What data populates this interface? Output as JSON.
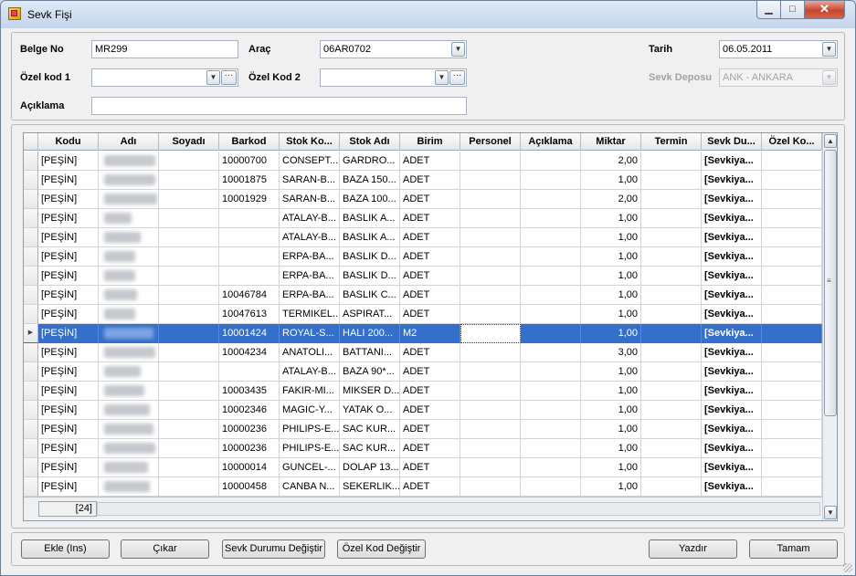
{
  "window": {
    "title": "Sevk Fişi",
    "min_symbol": "▁",
    "max_symbol": "□",
    "close_symbol": "✕"
  },
  "form": {
    "belge_no_label": "Belge No",
    "belge_no_value": "MR299",
    "arac_label": "Araç",
    "arac_value": "06AR0702",
    "tarih_label": "Tarih",
    "tarih_value": "06.05.2011",
    "ozel_kod1_label": "Özel kod 1",
    "ozel_kod1_value": "",
    "ozel_kod2_label": "Özel Kod 2",
    "ozel_kod2_value": "",
    "sevk_deposu_label": "Sevk Deposu",
    "sevk_deposu_value": "ANK - ANKARA",
    "aciklama_label": "Açıklama",
    "aciklama_value": "",
    "dropdown_glyph": "▼",
    "ellipsis_glyph": "···"
  },
  "grid": {
    "columns": [
      "",
      "Kodu",
      "Adı",
      "Soyadı",
      "Barkod",
      "Stok Ko...",
      "Stok Adı",
      "Birim",
      "Personel",
      "Açıklama",
      "Miktar",
      "Termin",
      "Sevk Du...",
      "Özel Ko..."
    ],
    "rows": [
      {
        "kodu": "[PEŞİN]",
        "barkod": "10000700",
        "stok_kodu": "CONSEPT...",
        "stok_adi": "GARDRO...",
        "birim": "ADET",
        "miktar": "2,00",
        "sevk": "[Sevkiya..."
      },
      {
        "kodu": "[PEŞİN]",
        "barkod": "10001875",
        "stok_kodu": "SARAN-B...",
        "stok_adi": "BAZA 150...",
        "birim": "ADET",
        "miktar": "1,00",
        "sevk": "[Sevkiya..."
      },
      {
        "kodu": "[PEŞİN]",
        "barkod": "10001929",
        "stok_kodu": "SARAN-B...",
        "stok_adi": "BAZA 100...",
        "birim": "ADET",
        "miktar": "2,00",
        "sevk": "[Sevkiya..."
      },
      {
        "kodu": "[PEŞİN]",
        "barkod": "",
        "stok_kodu": "ATALAY-B...",
        "stok_adi": "BASLIK A...",
        "birim": "ADET",
        "miktar": "1,00",
        "sevk": "[Sevkiya..."
      },
      {
        "kodu": "[PEŞİN]",
        "barkod": "",
        "stok_kodu": "ATALAY-B...",
        "stok_adi": "BASLIK A...",
        "birim": "ADET",
        "miktar": "1,00",
        "sevk": "[Sevkiya..."
      },
      {
        "kodu": "[PEŞİN]",
        "barkod": "",
        "stok_kodu": "ERPA-BA...",
        "stok_adi": "BASLIK D...",
        "birim": "ADET",
        "miktar": "1,00",
        "sevk": "[Sevkiya..."
      },
      {
        "kodu": "[PEŞİN]",
        "barkod": "",
        "stok_kodu": "ERPA-BA...",
        "stok_adi": "BASLIK D...",
        "birim": "ADET",
        "miktar": "1,00",
        "sevk": "[Sevkiya..."
      },
      {
        "kodu": "[PEŞİN]",
        "barkod": "10046784",
        "stok_kodu": "ERPA-BA...",
        "stok_adi": "BASLIK C...",
        "birim": "ADET",
        "miktar": "1,00",
        "sevk": "[Sevkiya..."
      },
      {
        "kodu": "[PEŞİN]",
        "barkod": "10047613",
        "stok_kodu": "TERMIKEL...",
        "stok_adi": "ASPIRAT...",
        "birim": "ADET",
        "miktar": "1,00",
        "sevk": "[Sevkiya..."
      },
      {
        "kodu": "[PEŞİN]",
        "barkod": "10001424",
        "stok_kodu": "ROYAL-S...",
        "stok_adi": "HALI 200...",
        "birim": "M2",
        "miktar": "1,00",
        "sevk": "[Sevkiya...",
        "selected": true
      },
      {
        "kodu": "[PEŞİN]",
        "barkod": "10004234",
        "stok_kodu": "ANATOLI...",
        "stok_adi": "BATTANI...",
        "birim": "ADET",
        "miktar": "3,00",
        "sevk": "[Sevkiya..."
      },
      {
        "kodu": "[PEŞİN]",
        "barkod": "",
        "stok_kodu": "ATALAY-B...",
        "stok_adi": "BAZA 90*...",
        "birim": "ADET",
        "miktar": "1,00",
        "sevk": "[Sevkiya..."
      },
      {
        "kodu": "[PEŞİN]",
        "barkod": "10003435",
        "stok_kodu": "FAKIR-MI...",
        "stok_adi": "MIKSER D...",
        "birim": "ADET",
        "miktar": "1,00",
        "sevk": "[Sevkiya..."
      },
      {
        "kodu": "[PEŞİN]",
        "barkod": "10002346",
        "stok_kodu": "MAGIC-Y...",
        "stok_adi": "YATAK O...",
        "birim": "ADET",
        "miktar": "1,00",
        "sevk": "[Sevkiya..."
      },
      {
        "kodu": "[PEŞİN]",
        "barkod": "10000236",
        "stok_kodu": "PHILIPS-E...",
        "stok_adi": "SAC KUR...",
        "birim": "ADET",
        "miktar": "1,00",
        "sevk": "[Sevkiya..."
      },
      {
        "kodu": "[PEŞİN]",
        "barkod": "10000236",
        "stok_kodu": "PHILIPS-E...",
        "stok_adi": "SAC KUR...",
        "birim": "ADET",
        "miktar": "1,00",
        "sevk": "[Sevkiya..."
      },
      {
        "kodu": "[PEŞİN]",
        "barkod": "10000014",
        "stok_kodu": "GUNCEL-...",
        "stok_adi": "DOLAP 13...",
        "birim": "ADET",
        "miktar": "1,00",
        "sevk": "[Sevkiya..."
      },
      {
        "kodu": "[PEŞİN]",
        "barkod": "10000458",
        "stok_kodu": "CANBA N...",
        "stok_adi": "SEKERLIK...",
        "birim": "ADET",
        "miktar": "1,00",
        "sevk": "[Sevkiya..."
      }
    ],
    "row_count": "[24]",
    "scroll_up_glyph": "▲",
    "scroll_down_glyph": "▼",
    "row_pointer_glyph": "▶",
    "thumb_grip_glyph": "≡"
  },
  "buttons": {
    "ekle": "Ekle (Ins)",
    "cikar": "Çıkar",
    "sevk_durumu": "Sevk Durumu Değiştir",
    "ozel_kod": "Özel Kod Değiştir",
    "yazdir": "Yazdır",
    "tamam": "Tamam"
  }
}
